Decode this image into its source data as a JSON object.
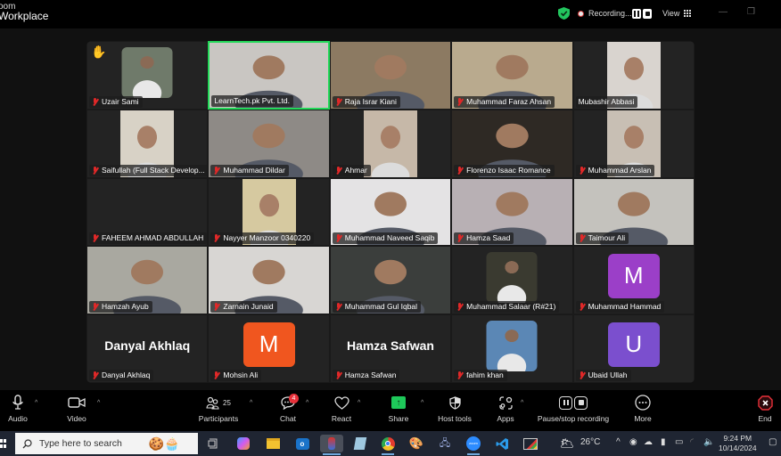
{
  "window": {
    "brand_line1": "oom",
    "brand_line2": "Workplace",
    "recording_label": "Recording...",
    "view_label": "View",
    "minimize": "—",
    "restore": "❐",
    "colors": {
      "active_speaker_border": "#23d959",
      "shield": "#22c55e",
      "mute_red": "#e02828"
    }
  },
  "participants": [
    {
      "name": "Uzair Sami",
      "type": "photo",
      "muted": true,
      "hand_raised": true,
      "bg": "#6f7a6a"
    },
    {
      "name": "LearnTech.pk Pvt. Ltd.",
      "type": "video",
      "muted": false,
      "active_speaker": true,
      "bg": "#c9c6c2"
    },
    {
      "name": "Raja Israr Kiani",
      "type": "video",
      "muted": true,
      "bg": "#8c7a62"
    },
    {
      "name": "Muhammad Faraz Ahsan",
      "type": "video",
      "muted": true,
      "bg": "#b9aa8e"
    },
    {
      "name": "Mubashir Abbasi",
      "type": "video-narrow",
      "muted": false,
      "bg": "#d9d4cf"
    },
    {
      "name": "Saifullah (Full Stack Develop...",
      "type": "video-narrow",
      "muted": true,
      "bg": "#d8d2c6"
    },
    {
      "name": "Muhammad Dildar",
      "type": "video",
      "muted": true,
      "bg": "#8e8a86"
    },
    {
      "name": "Ahmar",
      "type": "video-narrow",
      "muted": true,
      "bg": "#c6b8a8"
    },
    {
      "name": "Florenzo Isaac Romance",
      "type": "video",
      "muted": true,
      "bg": "#2e2924"
    },
    {
      "name": "Muhammad Arslan",
      "type": "video-narrow",
      "muted": true,
      "bg": "#c8bfb4"
    },
    {
      "name": "FAHEEM AHMAD ABDULLAH",
      "type": "empty",
      "muted": true
    },
    {
      "name": "Nayyer Manzoor 0340220",
      "type": "video-narrow",
      "muted": true,
      "bg": "#d6c9a0"
    },
    {
      "name": "Muhammad Naveed Saqib",
      "type": "video",
      "muted": true,
      "bg": "#e4e3e4"
    },
    {
      "name": "Hamza Saad",
      "type": "video",
      "muted": true,
      "bg": "#b8b0b4"
    },
    {
      "name": "Taimour Ali",
      "type": "video",
      "muted": true,
      "bg": "#c4c2bd"
    },
    {
      "name": "Hamzah Ayub",
      "type": "video",
      "muted": true,
      "bg": "#a9a8a0"
    },
    {
      "name": "Zarnain Junaid",
      "type": "video",
      "muted": true,
      "bg": "#d8d6d3"
    },
    {
      "name": "Muhammad Gul Iqbal",
      "type": "video",
      "muted": true,
      "bg": "#3b3e3c"
    },
    {
      "name": "Muhammad Salaar (R#21)",
      "type": "photo",
      "muted": true,
      "bg": "#3a3a30"
    },
    {
      "name": "Muhammad Hammad",
      "type": "avatar",
      "initial": "M",
      "avatar_color": "#9b3fc8",
      "muted": true
    },
    {
      "name": "Danyal Akhlaq",
      "type": "bigname",
      "muted": true
    },
    {
      "name": "Mohsin Ali",
      "type": "avatar",
      "initial": "M",
      "avatar_color": "#f0561f",
      "muted": true
    },
    {
      "name": "Hamza Safwan",
      "type": "bigname",
      "muted": true
    },
    {
      "name": "fahim khan",
      "type": "photo",
      "muted": true,
      "bg": "#5b87b5"
    },
    {
      "name": "Ubaid Ullah",
      "type": "avatar",
      "initial": "U",
      "avatar_color": "#7b4fce",
      "muted": true
    }
  ],
  "toolbar": {
    "audio": "Audio",
    "video": "Video",
    "participants": "Participants",
    "participants_count": "25",
    "chat": "Chat",
    "chat_badge": "4",
    "react": "React",
    "share": "Share",
    "host_tools": "Host tools",
    "apps": "Apps",
    "pause_stop_recording": "Pause/stop recording",
    "more": "More",
    "end": "End"
  },
  "taskbar": {
    "search_placeholder": "Type here to search",
    "weather": "26°C",
    "time": "9:24 PM",
    "date": "10/14/2024"
  }
}
